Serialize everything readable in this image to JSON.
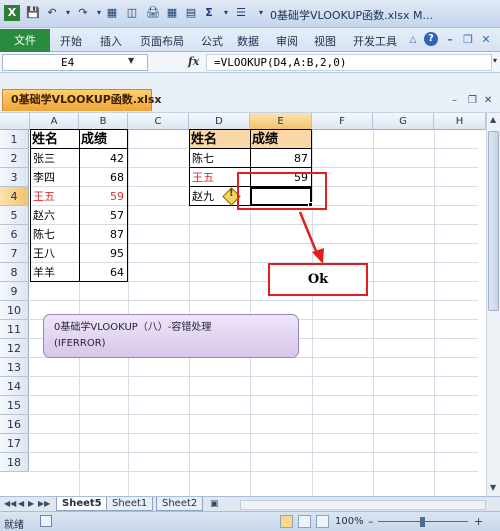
{
  "window": {
    "title": "0基础学VLOOKUP函数.xlsx M..."
  },
  "ribbon": {
    "file_tab": "文件",
    "tabs": [
      "开始",
      "插入",
      "页面布局",
      "公式",
      "数据",
      "审阅",
      "视图",
      "开发工具"
    ]
  },
  "formula_bar": {
    "name_box": "E4",
    "fx_label": "fx",
    "formula": "=VLOOKUP(D4,A:B,2,0)"
  },
  "workbook_tab": {
    "label": "0基础学VLOOKUP函数.xlsx"
  },
  "grid": {
    "columns": [
      "A",
      "B",
      "C",
      "D",
      "E",
      "F",
      "G",
      "H"
    ],
    "rows": [
      "1",
      "2",
      "3",
      "4",
      "5",
      "6",
      "7",
      "8",
      "9",
      "10",
      "11",
      "12",
      "13",
      "14",
      "15",
      "16",
      "17",
      "18"
    ],
    "left_table": {
      "headers": [
        "姓名",
        "成绩"
      ],
      "rows": [
        {
          "name": "张三",
          "score": "42"
        },
        {
          "name": "李四",
          "score": "68"
        },
        {
          "name": "王五",
          "score": "59"
        },
        {
          "name": "赵六",
          "score": "57"
        },
        {
          "name": "陈七",
          "score": "87"
        },
        {
          "name": "王八",
          "score": "95"
        },
        {
          "name": "羊羊",
          "score": "64"
        }
      ]
    },
    "right_table": {
      "headers": [
        "姓名",
        "成绩"
      ],
      "rows": [
        {
          "name": "陈七",
          "score": "87"
        },
        {
          "name": "王五",
          "score": "59"
        },
        {
          "name": "赵九",
          "score": ""
        }
      ]
    },
    "highlight_color": "#e03030",
    "header_fill_color": "#f9d7a7"
  },
  "annotations": {
    "ok_label": "Ok",
    "note_line1": "0基础学VLOOKUP（八）-容错处理",
    "note_line2": "(IFERROR)",
    "warning_icon": "warning-icon"
  },
  "sheets": {
    "tabs": [
      "Sheet5",
      "Sheet1",
      "Sheet2"
    ],
    "active": "Sheet5"
  },
  "status": {
    "ready": "就绪",
    "zoom": "100%"
  }
}
